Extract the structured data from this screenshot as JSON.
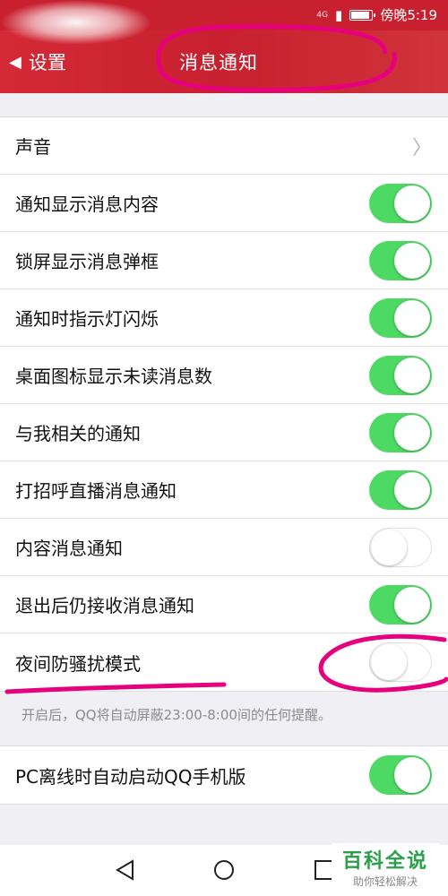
{
  "status_bar": {
    "signal": "4G",
    "time": "傍晚5:19"
  },
  "nav": {
    "back_label": "设置",
    "title": "消息通知"
  },
  "settings": [
    {
      "label": "声音",
      "control": "chevron"
    },
    {
      "label": "通知显示消息内容",
      "control": "toggle",
      "on": true
    },
    {
      "label": "锁屏显示消息弹框",
      "control": "toggle",
      "on": true
    },
    {
      "label": "通知时指示灯闪烁",
      "control": "toggle",
      "on": true
    },
    {
      "label": "桌面图标显示未读消息数",
      "control": "toggle",
      "on": true
    },
    {
      "label": "与我相关的通知",
      "control": "toggle",
      "on": true
    },
    {
      "label": "打招呼直播消息通知",
      "control": "toggle",
      "on": true
    },
    {
      "label": "内容消息通知",
      "control": "toggle",
      "on": false
    },
    {
      "label": "退出后仍接收消息通知",
      "control": "toggle",
      "on": true
    },
    {
      "label": "夜间防骚扰模式",
      "control": "toggle",
      "on": false
    }
  ],
  "night_mode_hint": "开启后，QQ将自动屏蔽23:00-8:00间的任何提醒。",
  "pc_offline": {
    "label": "PC离线时自动启动QQ手机版",
    "on": true
  },
  "watermark": {
    "title": "百科全说",
    "subtitle": "助你轻松解决"
  },
  "colors": {
    "header": "#c8202f",
    "toggle_on": "#4cd964",
    "annotation": "#e6007e",
    "watermark": "#2aa04a"
  }
}
